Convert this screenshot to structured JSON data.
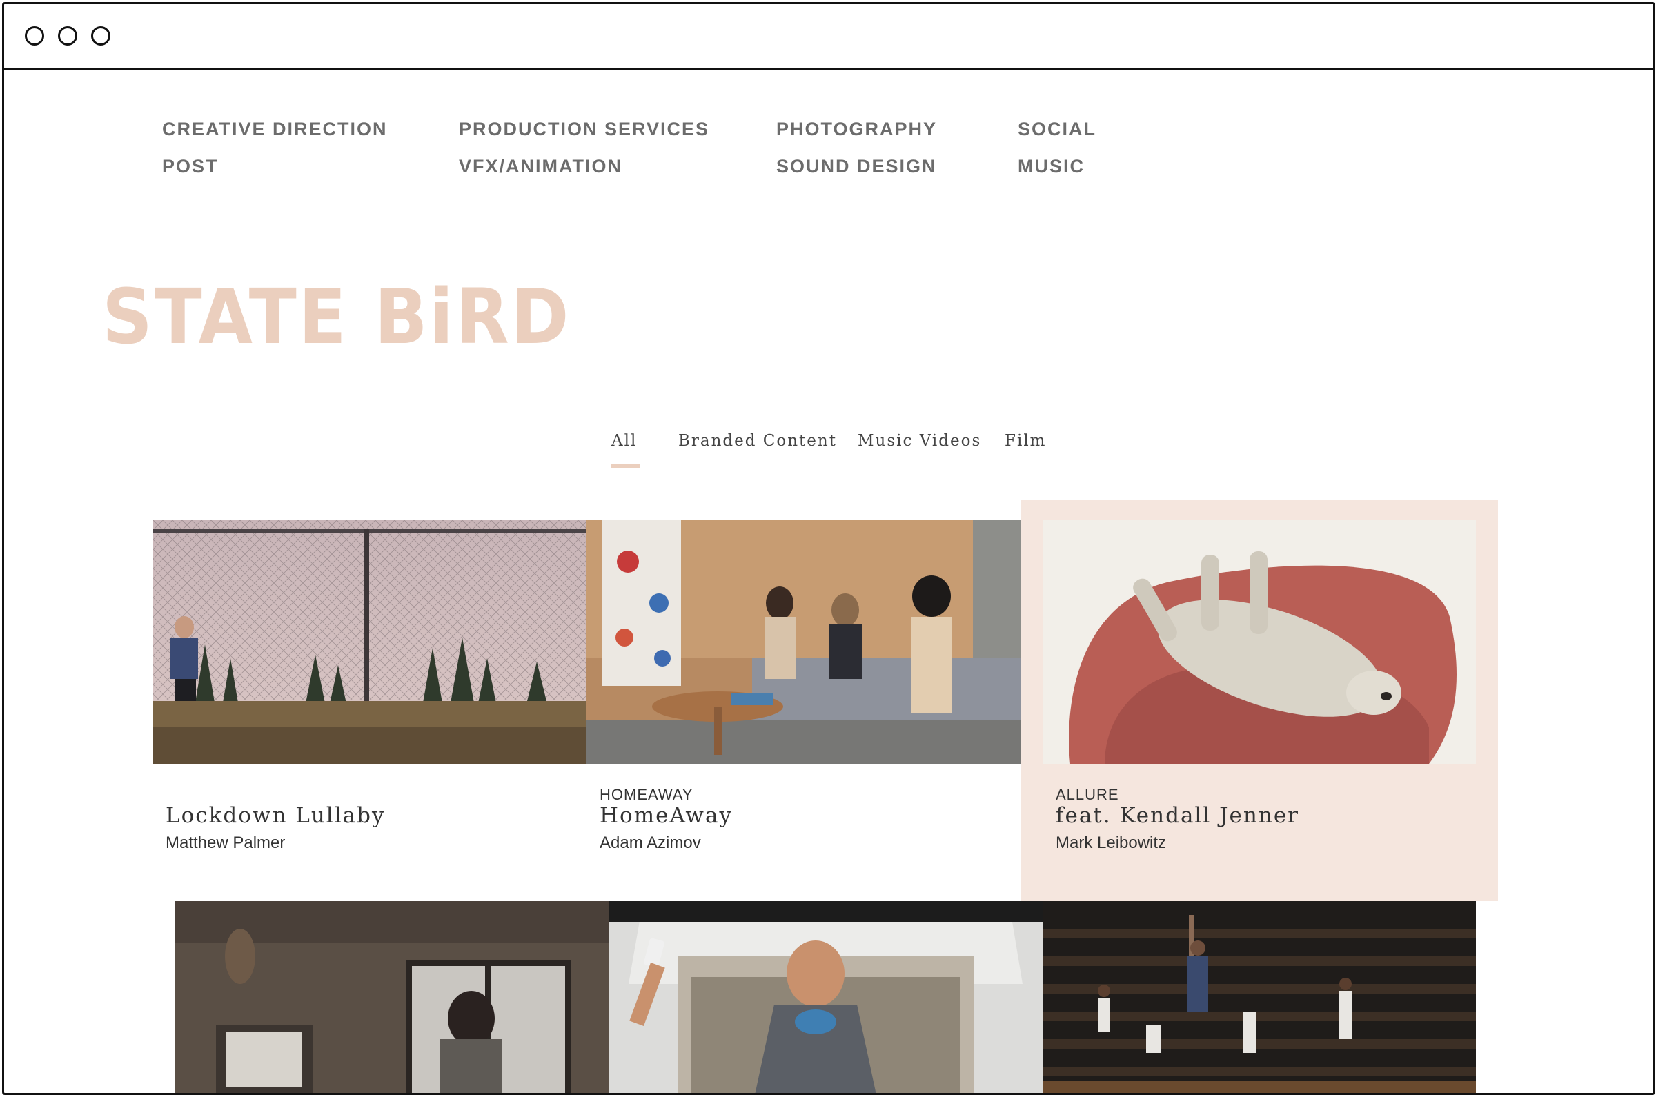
{
  "window": {
    "controls": [
      "close",
      "minimize",
      "maximize"
    ]
  },
  "nav": {
    "links": [
      "CREATIVE DIRECTION",
      "PRODUCTION SERVICES",
      "PHOTOGRAPHY",
      "SOCIAL",
      "POST",
      "VFX/ANIMATION",
      "SOUND DESIGN",
      "MUSIC"
    ]
  },
  "brand": {
    "logo_text": "STATE BiRD",
    "color": "#ebcfbe"
  },
  "filters": {
    "tabs": [
      "All",
      "Branded Content",
      "Music Videos",
      "Film"
    ],
    "active": "All"
  },
  "colors": {
    "accent": "#ebcfbe",
    "card_highlight": "#f5e6de",
    "nav_text": "#6c6c6c",
    "body_text": "#333333"
  },
  "projects": [
    {
      "client": "",
      "title": "Lockdown Lullaby",
      "director": "Matthew Palmer"
    },
    {
      "client": "HOMEAWAY",
      "title": "HomeAway",
      "director": "Adam Azimov"
    },
    {
      "client": "ALLURE",
      "title": "feat. Kendall Jenner",
      "director": "Mark Leibowitz"
    }
  ],
  "second_row_thumbnails": [
    "interior-window-scene",
    "car-selfie-scene",
    "dance-gym-scene"
  ]
}
